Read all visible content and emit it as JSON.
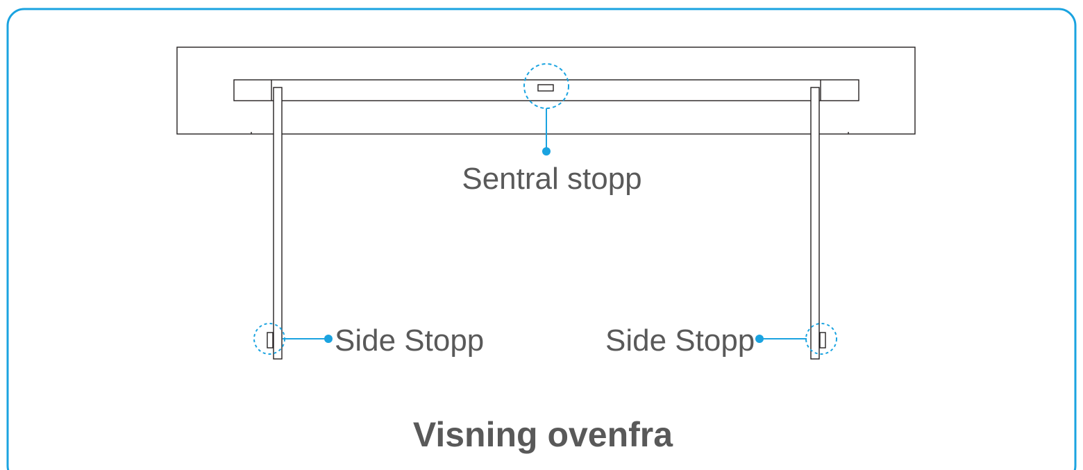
{
  "diagram": {
    "labels": {
      "central_stop": "Sentral stopp",
      "side_stop_left": "Side Stopp",
      "side_stop_right": "Side Stopp"
    },
    "caption": "Visning ovenfra"
  },
  "colors": {
    "frame_border": "#1aa3e0",
    "callout": "#1aa3e0",
    "line": "#231f20",
    "text": "#595959"
  }
}
